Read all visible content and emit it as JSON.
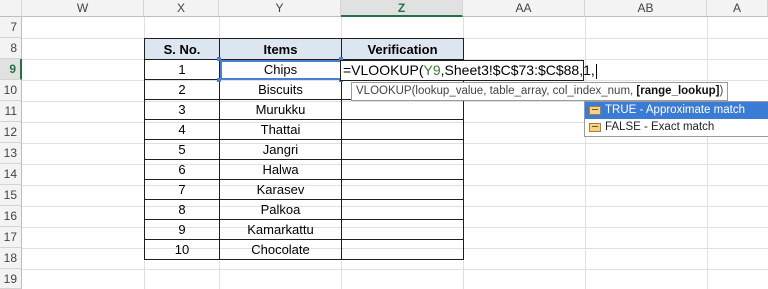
{
  "columns": [
    "W",
    "X",
    "Y",
    "Z",
    "AA",
    "AB",
    "A"
  ],
  "active_column": "Z",
  "rows": [
    "7",
    "8",
    "9",
    "10",
    "11",
    "12",
    "13",
    "14",
    "15",
    "16",
    "17",
    "18",
    "19"
  ],
  "active_row": "9",
  "table": {
    "headers": [
      "S. No.",
      "Items",
      "Verification"
    ],
    "rows": [
      {
        "sno": "1",
        "item": "Chips"
      },
      {
        "sno": "2",
        "item": "Biscuits"
      },
      {
        "sno": "3",
        "item": "Murukku"
      },
      {
        "sno": "4",
        "item": "Thattai"
      },
      {
        "sno": "5",
        "item": "Jangri"
      },
      {
        "sno": "6",
        "item": "Halwa"
      },
      {
        "sno": "7",
        "item": "Karasev"
      },
      {
        "sno": "8",
        "item": "Palkoa"
      },
      {
        "sno": "9",
        "item": "Kamarkattu"
      },
      {
        "sno": "10",
        "item": "Chocolate"
      }
    ]
  },
  "formula": {
    "prefix": "=VLOOKUP(",
    "ref": "Y9",
    "rest": ",Sheet3!$C$73:$C$88,1,"
  },
  "tooltip": {
    "text": "VLOOKUP(lookup_value, table_array, col_index_num, ",
    "bold": "[range_lookup]",
    "close": ")"
  },
  "autocomplete": [
    {
      "label": "TRUE - Approximate match",
      "selected": true
    },
    {
      "label": "FALSE - Exact match",
      "selected": false
    }
  ],
  "colors": {
    "header_fill": "#dce6f1",
    "selection": "#4a7fd1",
    "active_accent": "#217346",
    "ref_color": "#3c7d32"
  }
}
